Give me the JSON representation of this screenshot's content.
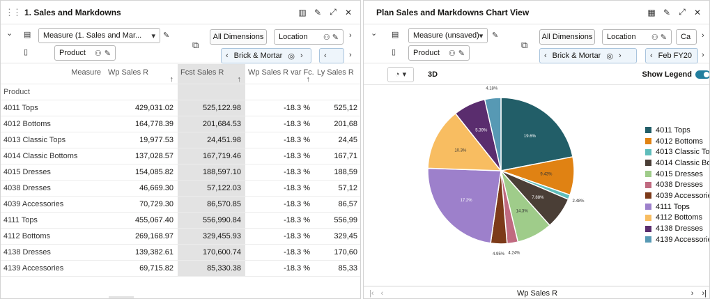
{
  "left_panel": {
    "title": "1. Sales and Markdowns",
    "measure_dim": "Measure (1. Sales and Mar...",
    "product_dim": "Product",
    "all_dimensions": "All Dimensions",
    "location_label": "Location",
    "location_value": "Brick & Mortar",
    "next_dim_value": "",
    "table": {
      "measure_header": "Measure",
      "product_header": "Product",
      "columns": [
        "Wp Sales R",
        "Fcst Sales R",
        "Wp Sales R var Fc...",
        "Ly Sales R"
      ],
      "rows": [
        {
          "label": "4011 Tops",
          "values": [
            "429,031.02",
            "525,122.98",
            "-18.3 %",
            "525,12"
          ]
        },
        {
          "label": "4012 Bottoms",
          "values": [
            "164,778.39",
            "201,684.53",
            "-18.3 %",
            "201,68"
          ]
        },
        {
          "label": "4013 Classic Tops",
          "values": [
            "19,977.53",
            "24,451.98",
            "-18.3 %",
            "24,45"
          ]
        },
        {
          "label": "4014 Classic Bottoms",
          "values": [
            "137,028.57",
            "167,719.46",
            "-18.3 %",
            "167,71"
          ]
        },
        {
          "label": "4015 Dresses",
          "values": [
            "154,085.82",
            "188,597.10",
            "-18.3 %",
            "188,59"
          ]
        },
        {
          "label": "4038 Dresses",
          "values": [
            "46,669.30",
            "57,122.03",
            "-18.3 %",
            "57,12"
          ]
        },
        {
          "label": "4039 Accessories",
          "values": [
            "70,729.30",
            "86,570.85",
            "-18.3 %",
            "86,57"
          ]
        },
        {
          "label": "4111 Tops",
          "values": [
            "455,067.40",
            "556,990.84",
            "-18.3 %",
            "556,99"
          ]
        },
        {
          "label": "4112 Bottoms",
          "values": [
            "269,168.97",
            "329,455.93",
            "-18.3 %",
            "329,45"
          ]
        },
        {
          "label": "4138 Dresses",
          "values": [
            "139,382.61",
            "170,600.74",
            "-18.3 %",
            "170,60"
          ]
        },
        {
          "label": "4139 Accessories",
          "values": [
            "69,715.82",
            "85,330.38",
            "-18.3 %",
            "85,33"
          ]
        }
      ]
    }
  },
  "right_panel": {
    "title": "Plan Sales and Markdowns Chart View",
    "measure_dim": "Measure (unsaved)",
    "product_dim": "Product",
    "all_dimensions": "All Dimensions",
    "location_label": "Location",
    "calendar_label": "Ca",
    "location_value": "Brick & Mortar",
    "period_value": "Feb FY20",
    "view_3d": "3D",
    "show_legend": "Show Legend",
    "footer_measure": "Wp Sales R"
  },
  "chart_data": {
    "type": "pie",
    "title": "",
    "measure": "Wp Sales R",
    "slices": [
      {
        "name": "4011 Tops",
        "value": 429031.02,
        "label": "19.6%",
        "color": "#225e68"
      },
      {
        "name": "4012 Bottoms",
        "value": 164778.39,
        "label": "9.43%",
        "color": "#e08213"
      },
      {
        "name": "4013 Classic Tops",
        "value": 19977.53,
        "label": "2.48%",
        "color": "#5fbdbb"
      },
      {
        "name": "4014 Classic Bo...",
        "value": 137028.57,
        "label": "7.88%",
        "color": "#4a3e36"
      },
      {
        "name": "4015 Dresses",
        "value": 154085.82,
        "label": "14.3%",
        "color": "#9fcc8a"
      },
      {
        "name": "4038 Dresses",
        "value": 46669.3,
        "label": "4.24%",
        "color": "#c06a80"
      },
      {
        "name": "4039 Accessories",
        "value": 70729.3,
        "label": "4.95%",
        "color": "#7c3a19"
      },
      {
        "name": "4111 Tops",
        "value": 455067.4,
        "label": "17.2%",
        "color": "#9d80cb"
      },
      {
        "name": "4112 Bottoms",
        "value": 269168.97,
        "label": "10.3%",
        "color": "#f8bd61"
      },
      {
        "name": "4138 Dresses",
        "value": 139382.61,
        "label": "5.39%",
        "color": "#5a2d6e"
      },
      {
        "name": "4139 Accessories",
        "value": 69715.82,
        "label": "4.18%",
        "color": "#5799b4"
      }
    ],
    "legend_position": "right"
  }
}
